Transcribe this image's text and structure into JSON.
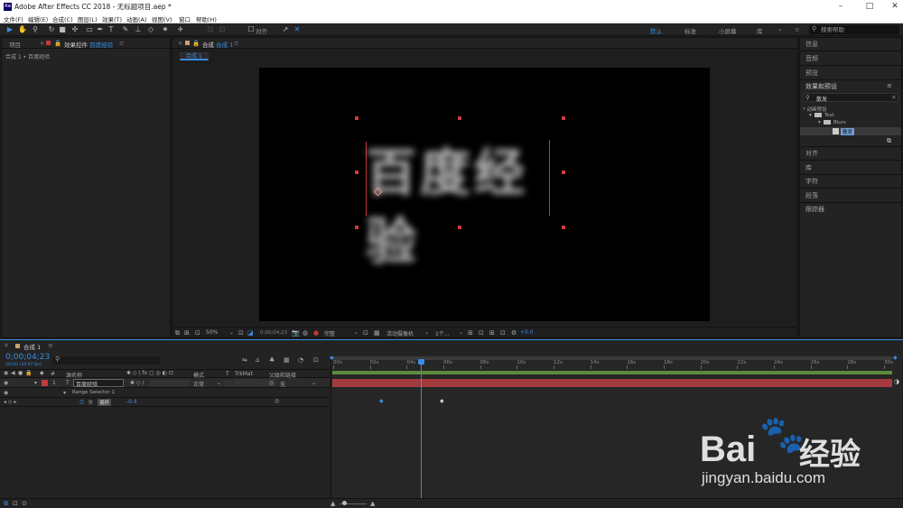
{
  "window": {
    "title": "Adobe After Effects CC 2018 - 无标题项目.aep *",
    "logo": "Ae"
  },
  "menu": [
    "文件(F)",
    "编辑(E)",
    "合成(C)",
    "图层(L)",
    "效果(T)",
    "动画(A)",
    "视图(V)",
    "窗口",
    "帮助(H)"
  ],
  "toolbar": {
    "align_label": "对齐",
    "workspaces": [
      "默认",
      "标准",
      "小屏幕",
      "库"
    ],
    "search_placeholder": "搜索帮助"
  },
  "project_panel": {
    "tab_project": "项目",
    "tab_effects_prefix": "效果控件",
    "tab_effects_layer": "百度经验",
    "breadcrumb": "合成 1 • 百度经验"
  },
  "comp_panel": {
    "tab_prefix": "合成",
    "tab_name": "合成 1",
    "sub_tab": "合成 1",
    "canvas_text": "百度经验",
    "zoom": "50%",
    "timecode": "0;00;04;23",
    "resolution": "完整",
    "camera": "活动摄像机",
    "views": "1个...",
    "exposure": "+0.0"
  },
  "right_panel": {
    "items_top": [
      "信息",
      "音频",
      "预览"
    ],
    "effects_presets_title": "效果和预设",
    "search_value": "散发",
    "tree": {
      "root": "* 动画预设",
      "folder1": "Text",
      "folder2": "Blurs",
      "item": "散发"
    },
    "items_bottom": [
      "对齐",
      "库",
      "字符",
      "段落",
      "跟踪器"
    ]
  },
  "timeline": {
    "tab": "合成 1",
    "timecode": "0;00;04;23",
    "frames": "00143 (29.97 fps)",
    "columns": {
      "num": "#",
      "name": "源名称",
      "mode": "模式",
      "t": "T",
      "trkmat": "TrkMat",
      "parent": "父级和链接"
    },
    "layer": {
      "index": "1",
      "type": "T",
      "name": "百度经验",
      "mode": "正常",
      "parent": "无"
    },
    "range_selector": "Range Selector 1",
    "property": {
      "name": "偏移",
      "value": "-0.4"
    },
    "ruler": [
      "00s",
      "02s",
      "04s",
      "06s",
      "08s",
      "10s",
      "12s",
      "14s",
      "16s",
      "18s",
      "20s",
      "22s",
      "24s",
      "26s",
      "28s",
      "30s"
    ]
  },
  "watermark": {
    "brand": "Bai",
    "brand2": "经验",
    "url": "jingyan.baidu.com"
  },
  "colors": {
    "accent": "#3b8de0",
    "layer_bar": "#a33a3d",
    "handle": "#d03a3a"
  }
}
